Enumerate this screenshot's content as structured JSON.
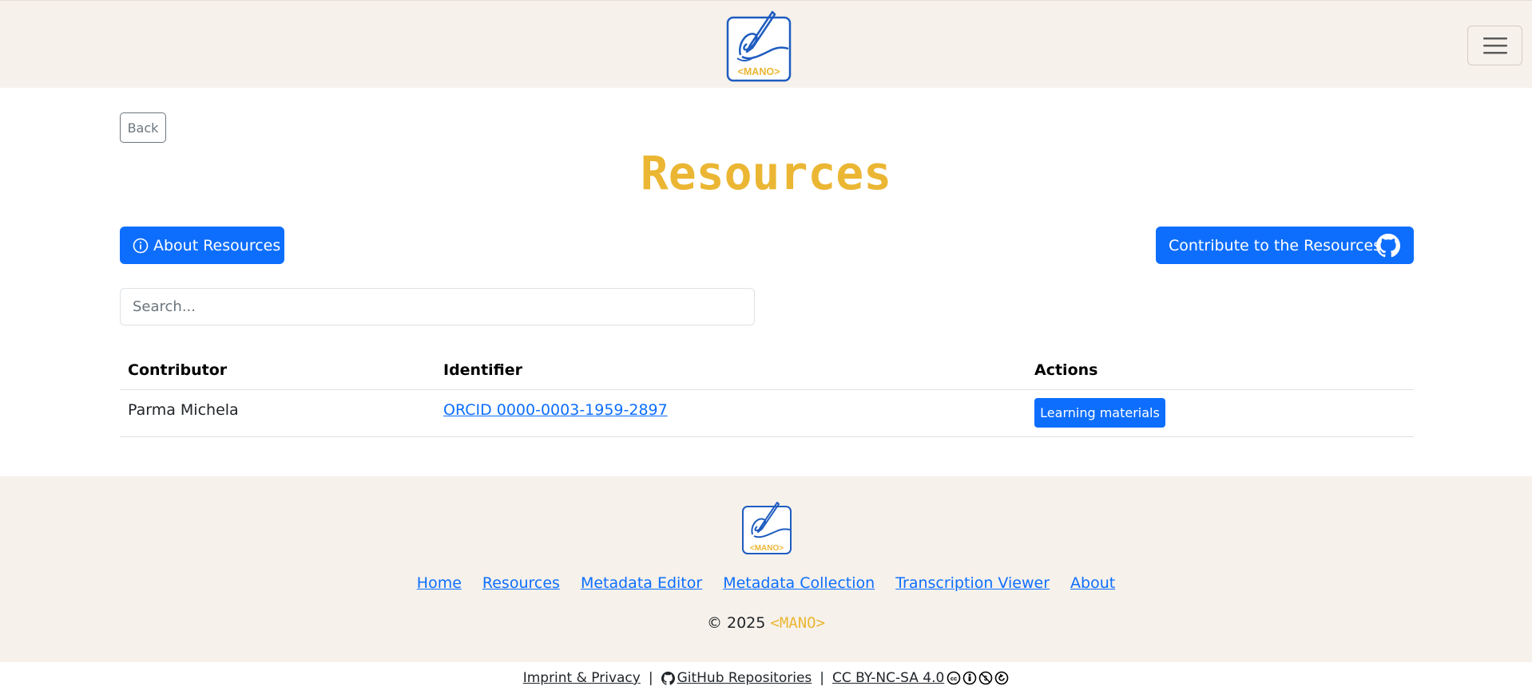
{
  "header": {
    "logo_text": "<MANO>",
    "toggle_icon": "hamburger-icon"
  },
  "back_label": "Back",
  "page_title": "Resources",
  "about_button": {
    "label": "About Resources",
    "icon": "info-circle-icon"
  },
  "contribute_button": {
    "label": "Contribute to the Resources",
    "icon": "github-icon"
  },
  "search": {
    "placeholder": "Search..."
  },
  "table": {
    "headers": [
      "Contributor",
      "Identifier",
      "Actions"
    ],
    "rows": [
      {
        "contributor": "Parma Michela",
        "identifier": "ORCID 0000-0003-1959-2897",
        "action": "Learning materials"
      }
    ]
  },
  "footer": {
    "logo_text": "<MANO>",
    "links": [
      "Home",
      "Resources",
      "Metadata Editor",
      "Metadata Collection",
      "Transcription Viewer",
      "About"
    ],
    "copyright_prefix": "© 2025",
    "copyright_brand": "<MANO>"
  },
  "bottom_bar": {
    "imprint": "Imprint & Privacy",
    "separator": "|",
    "github": "GitHub Repositories",
    "license": "CC BY-NC-SA 4.0"
  },
  "colors": {
    "primary": "#0d6efd",
    "brand_yellow": "#ebb633",
    "logo_blue": "#1f5cc0",
    "header_bg": "#f6f1eb"
  }
}
